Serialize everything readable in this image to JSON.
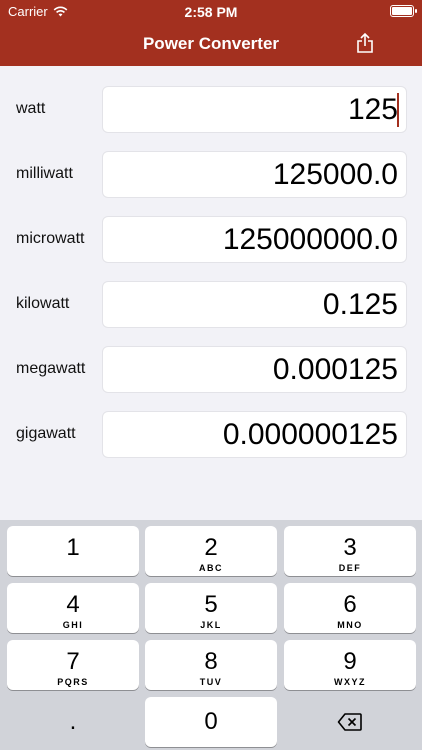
{
  "status": {
    "carrier": "Carrier",
    "time": "2:58 PM"
  },
  "nav": {
    "title": "Power Converter",
    "share_icon": "share-icon"
  },
  "colors": {
    "accent": "#a3301f",
    "background": "#f2f2f7"
  },
  "units": [
    {
      "label": "watt",
      "value": "125"
    },
    {
      "label": "milliwatt",
      "value": "125000.0"
    },
    {
      "label": "microwatt",
      "value": "125000000.0"
    },
    {
      "label": "kilowatt",
      "value": "0.125"
    },
    {
      "label": "megawatt",
      "value": "0.000125"
    },
    {
      "label": "gigawatt",
      "value": "0.000000125"
    }
  ],
  "keypad": {
    "k1": {
      "num": "1",
      "letters": ""
    },
    "k2": {
      "num": "2",
      "letters": "ABC"
    },
    "k3": {
      "num": "3",
      "letters": "DEF"
    },
    "k4": {
      "num": "4",
      "letters": "GHI"
    },
    "k5": {
      "num": "5",
      "letters": "JKL"
    },
    "k6": {
      "num": "6",
      "letters": "MNO"
    },
    "k7": {
      "num": "7",
      "letters": "PQRS"
    },
    "k8": {
      "num": "8",
      "letters": "TUV"
    },
    "k9": {
      "num": "9",
      "letters": "WXYZ"
    },
    "dot": ".",
    "k0": "0",
    "delete_icon": "delete-backspace-icon"
  }
}
